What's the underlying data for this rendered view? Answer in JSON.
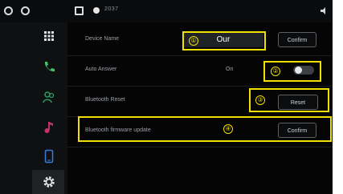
{
  "status_bar": {
    "time": "2037"
  },
  "sidebar": {
    "items": [
      {
        "icon": "grid-icon"
      },
      {
        "icon": "phone-icon"
      },
      {
        "icon": "contacts-icon"
      },
      {
        "icon": "music-icon"
      },
      {
        "icon": "device-icon"
      },
      {
        "icon": "settings-icon"
      }
    ]
  },
  "settings": {
    "device_name": {
      "label": "Device Name",
      "value": "Our",
      "button": "Confirm"
    },
    "auto_answer": {
      "label": "Auto Answer",
      "state": "On"
    },
    "bluetooth_reset": {
      "label": "Bluetooth Reset",
      "button": "Reset"
    },
    "firmware_update": {
      "label": "Bluetooth firmware update",
      "button": "Confirm"
    }
  },
  "annotations": [
    "①",
    "②",
    "③",
    "④"
  ],
  "colors": {
    "highlight": "#f2e000",
    "background": "#050506",
    "sidebar": "#0e1012"
  }
}
